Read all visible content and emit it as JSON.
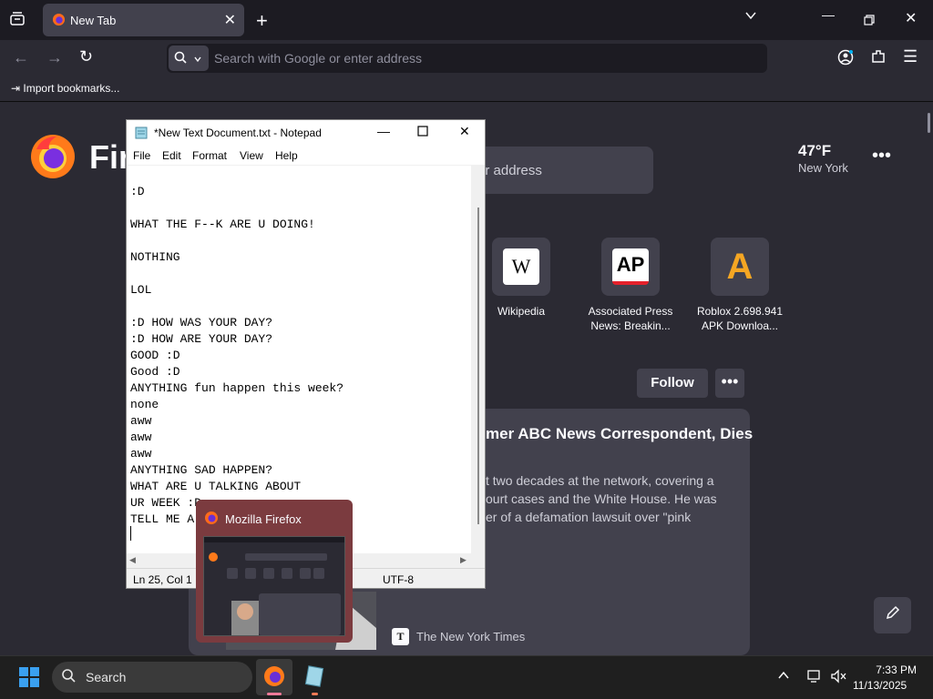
{
  "browser": {
    "tab_title": "New Tab",
    "url_placeholder": "Search with Google or enter address",
    "bookmark_import_label": "Import bookmarks..."
  },
  "newtab": {
    "wordmark": "Fir",
    "search_placeholder_partial": "er address",
    "weather": {
      "temp": "47°F",
      "city": "New York"
    },
    "top_sites": [
      {
        "label_line1": "Wikipedia",
        "label_line2": "",
        "icon_text": "W"
      },
      {
        "label_line1": "Associated Press",
        "label_line2": "News: Breakin...",
        "icon_text": "AP"
      },
      {
        "label_line1": "Roblox 2.698.941",
        "label_line2": "APK Downloa...",
        "icon_text": "A"
      }
    ],
    "follow_label": "Follow",
    "story": {
      "title_partial": "mer ABC News Correspondent, Dies",
      "excerpt_lines": [
        "t two decades at the network, covering a",
        "ourt cases and the White House. He was",
        "er of a defamation lawsuit over \"pink"
      ],
      "source": "The New York Times"
    }
  },
  "notepad": {
    "title": "*New Text Document.txt - Notepad",
    "menu": [
      "File",
      "Edit",
      "Format",
      "View",
      "Help"
    ],
    "text": ":D\n\nWHAT THE F--K ARE U DOING!\n\nNOTHING\n\nLOL\n\n:D HOW WAS YOUR DAY?\n:D HOW ARE YOUR DAY?\nGOOD :D\nGood :D\nANYTHING fun happen this week?\nnone\naww\naww\naww\nANYTHING SAD HAPPEN?\nWHAT ARE U TALKING ABOUT\nUR WEEK :D\nTELL ME A",
    "status_position": "Ln 25, Col 1",
    "status_encoding": "UTF-8"
  },
  "preview": {
    "title": "Mozilla Firefox"
  },
  "taskbar": {
    "search_label": "Search",
    "time": "7:33 PM",
    "date": "11/13/2025"
  },
  "colors": {
    "firefox_bg": "#2b2a33",
    "card_bg": "#42414d",
    "ap_red": "#e5212b",
    "roblox_orange": "#f5a623",
    "preview_bg": "#7b3b3f"
  }
}
